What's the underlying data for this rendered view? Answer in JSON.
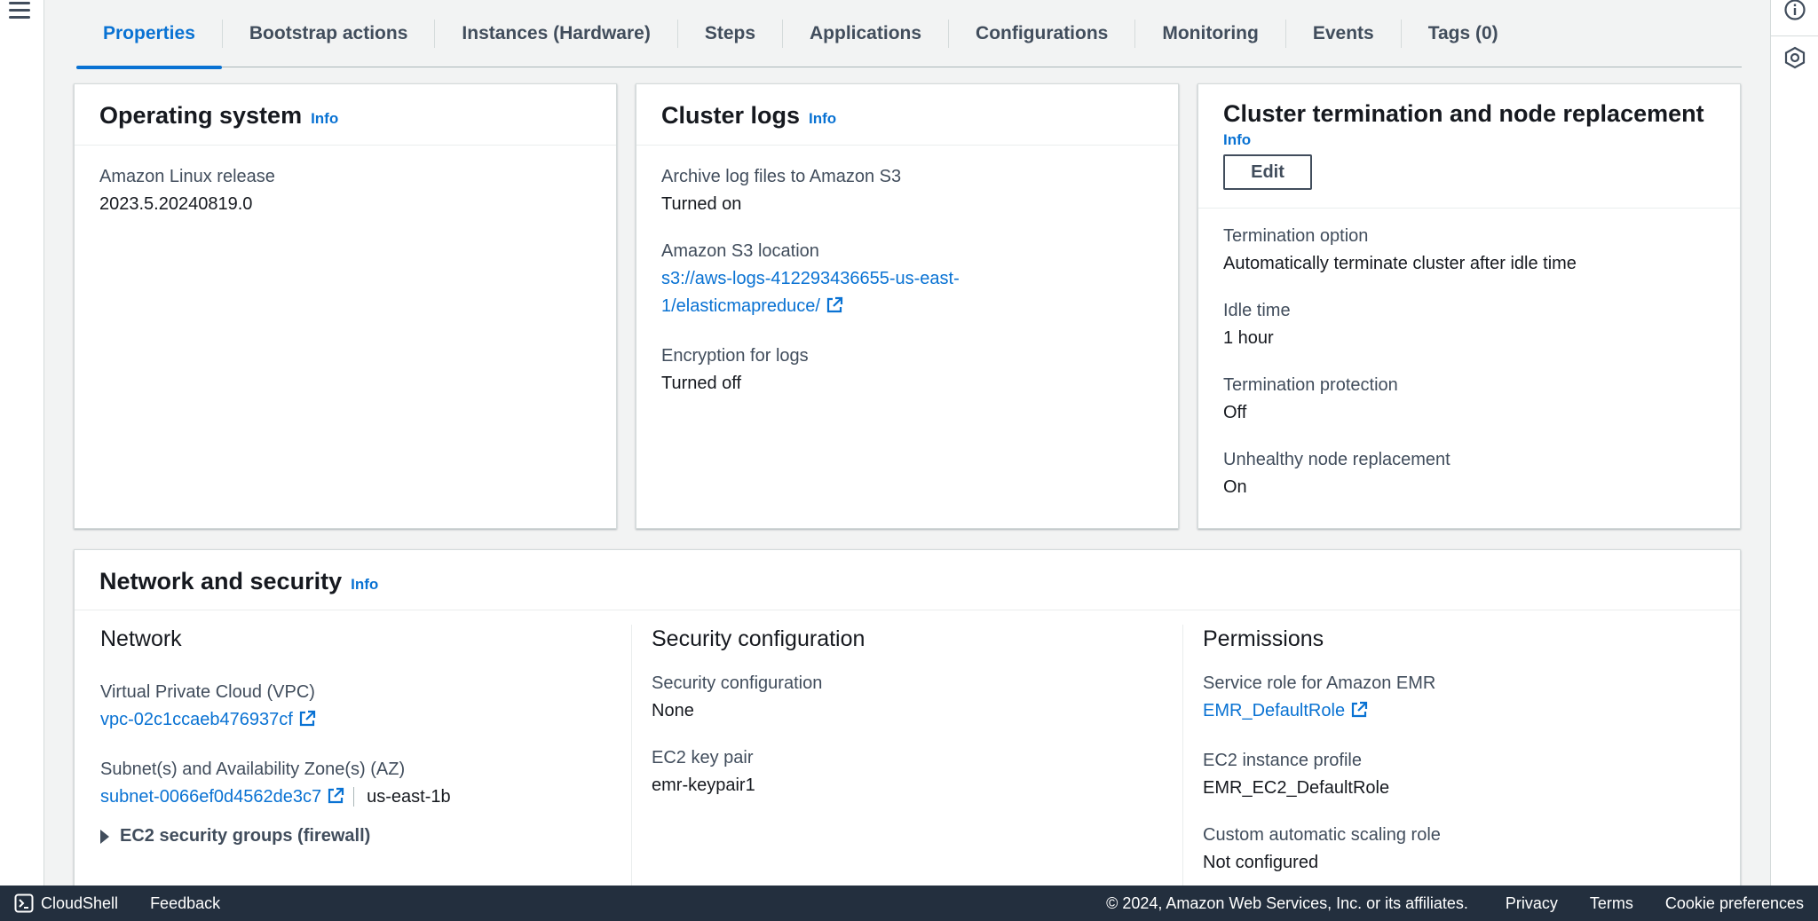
{
  "tabs": [
    {
      "label": "Properties"
    },
    {
      "label": "Bootstrap actions"
    },
    {
      "label": "Instances (Hardware)"
    },
    {
      "label": "Steps"
    },
    {
      "label": "Applications"
    },
    {
      "label": "Configurations"
    },
    {
      "label": "Monitoring"
    },
    {
      "label": "Events"
    },
    {
      "label": "Tags (0)"
    }
  ],
  "os_panel": {
    "title": "Operating system",
    "info": "Info",
    "release_label": "Amazon Linux release",
    "release_value": "2023.5.20240819.0"
  },
  "logs_panel": {
    "title": "Cluster logs",
    "info": "Info",
    "archive_label": "Archive log files to Amazon S3",
    "archive_value": "Turned on",
    "s3_label": "Amazon S3 location",
    "s3_value_line1": "s3://aws-logs-412293436655-us-east-",
    "s3_value_line2": "1/elasticmapreduce/",
    "encryption_label": "Encryption for logs",
    "encryption_value": "Turned off"
  },
  "termination_panel": {
    "title": "Cluster termination and node replacement",
    "info": "Info",
    "edit_label": "Edit",
    "option_label": "Termination option",
    "option_value": "Automatically terminate cluster after idle time",
    "idle_label": "Idle time",
    "idle_value": "1 hour",
    "protection_label": "Termination protection",
    "protection_value": "Off",
    "unhealthy_label": "Unhealthy node replacement",
    "unhealthy_value": "On"
  },
  "network_panel": {
    "title": "Network and security",
    "info": "Info",
    "network": {
      "heading": "Network",
      "vpc_label": "Virtual Private Cloud (VPC)",
      "vpc_value": "vpc-02c1ccaeb476937cf",
      "subnet_label": "Subnet(s) and Availability Zone(s) (AZ)",
      "subnet_value": "subnet-0066ef0d4562de3c7",
      "az_value": "us-east-1b",
      "sg_label": "EC2 security groups (firewall)"
    },
    "security": {
      "heading": "Security configuration",
      "config_label": "Security configuration",
      "config_value": "None",
      "keypair_label": "EC2 key pair",
      "keypair_value": "emr-keypair1"
    },
    "permissions": {
      "heading": "Permissions",
      "service_role_label": "Service role for Amazon EMR",
      "service_role_value": "EMR_DefaultRole",
      "profile_label": "EC2 instance profile",
      "profile_value": "EMR_EC2_DefaultRole",
      "scaling_label": "Custom automatic scaling role",
      "scaling_value": "Not configured"
    }
  },
  "footer": {
    "cloudshell": "CloudShell",
    "feedback": "Feedback",
    "copyright": "© 2024, Amazon Web Services, Inc. or its affiliates.",
    "privacy": "Privacy",
    "terms": "Terms",
    "cookies": "Cookie preferences"
  },
  "colors": {
    "link": "#0972d3",
    "footer_bg": "#232f3e",
    "page_bg": "#f2f3f3"
  }
}
